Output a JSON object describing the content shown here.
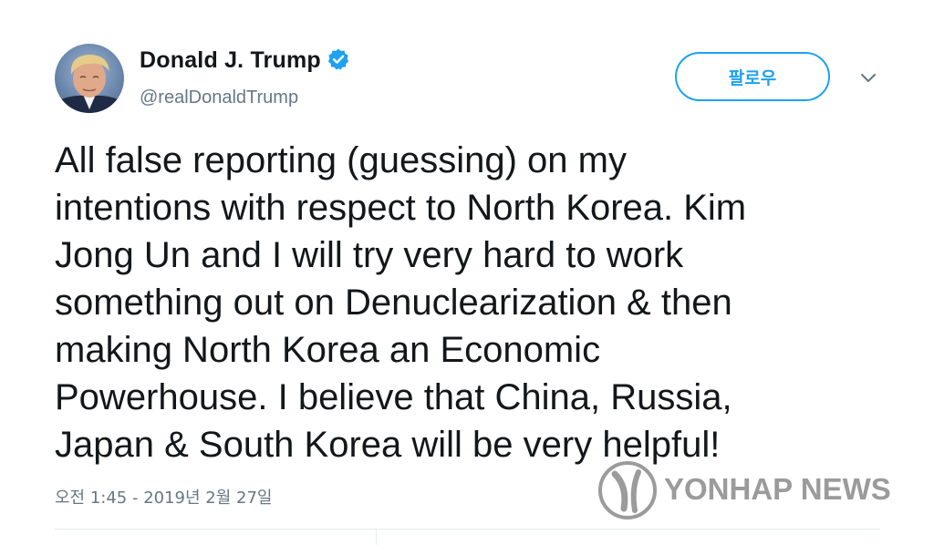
{
  "author": {
    "display_name": "Donald J. Trump",
    "handle": "@realDonaldTrump",
    "verified": true
  },
  "follow_button": {
    "label": "팔로우"
  },
  "tweet": {
    "text": "All false reporting (guessing) on my\nintentions with respect to North Korea. Kim\nJong Un and I will try very hard to work\nsomething out on Denuclearization & then\nmaking North Korea an Economic\nPowerhouse. I believe that China, Russia,\nJapan & South Korea will be very helpful!",
    "timestamp": "오전 1:45 - 2019년 2월 27일"
  },
  "watermark": {
    "text": "YONHAP NEWS"
  },
  "icons": {
    "verified": "verified-badge-icon",
    "more": "chevron-down-icon",
    "avatar": "avatar-photo"
  },
  "colors": {
    "accent": "#1da1f2",
    "text_primary": "#14171a",
    "text_secondary": "#657786",
    "divider": "#e6ecf0"
  }
}
